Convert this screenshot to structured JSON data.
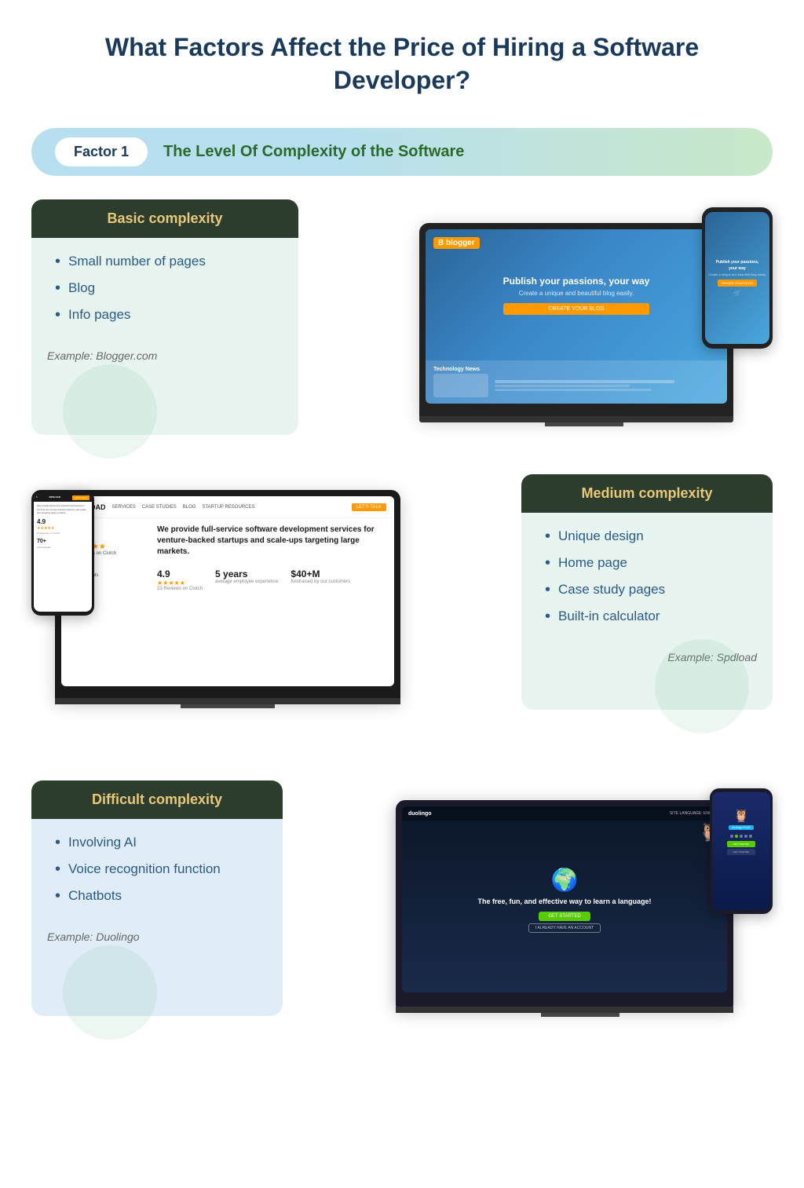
{
  "header": {
    "title": "What Factors Affect the Price of Hiring a Software Developer?"
  },
  "factor1": {
    "badge": "Factor 1",
    "title": "The Level Of Complexity of the Software"
  },
  "basic": {
    "header": "Basic complexity",
    "items": [
      "Small number of pages",
      "Blog",
      "Info pages"
    ],
    "example": "Example: Blogger.com"
  },
  "medium": {
    "header": "Medium complexity",
    "items": [
      "Unique design",
      "Home page",
      "Case study pages",
      "Built-in calculator"
    ],
    "example": "Example: Spdload"
  },
  "difficult": {
    "header": "Difficult complexity",
    "items": [
      "Involving AI",
      "Voice recognition function",
      "Chatbots"
    ],
    "example": "Example: Duolingo"
  },
  "spdload": {
    "nav_logo": "SPD LOAD",
    "nav_links": [
      "SERVICES",
      "CASE STUDIES",
      "BLOG",
      "STARTUP RESOURCES"
    ],
    "nav_cta": "LET'S TALK",
    "hero_text": "We provide full-service software development services for venture-backed startups and scale-ups targeting large markets.",
    "rating": "4.9",
    "stars": "★★★★★",
    "clutch_label": "23 Reviews on Clutch",
    "stat1_val": "70+",
    "stat1_label": "professionals",
    "stat2_val": "5 years",
    "stat2_label": "average employee experience",
    "stat3_val": "$40+M",
    "stat3_label": "fundraised by our customers"
  },
  "blogger": {
    "tagline": "Publish your passions, your way",
    "sub": "Create a unique and beautiful blog easily.",
    "cta": "CREATE YOUR BLOG"
  },
  "duolingo": {
    "logo": "duolingo",
    "nav_link": "SITE LANGUAGE: ENGLISH",
    "headline": "The free, fun, and effective way to learn a language!",
    "cta_primary": "GET STARTED",
    "cta_secondary": "I ALREADY HAVE AN ACCOUNT",
    "owl_emoji": "🦉",
    "earth_emoji": "🌍",
    "plus_badge": "duolingo PLUS"
  }
}
